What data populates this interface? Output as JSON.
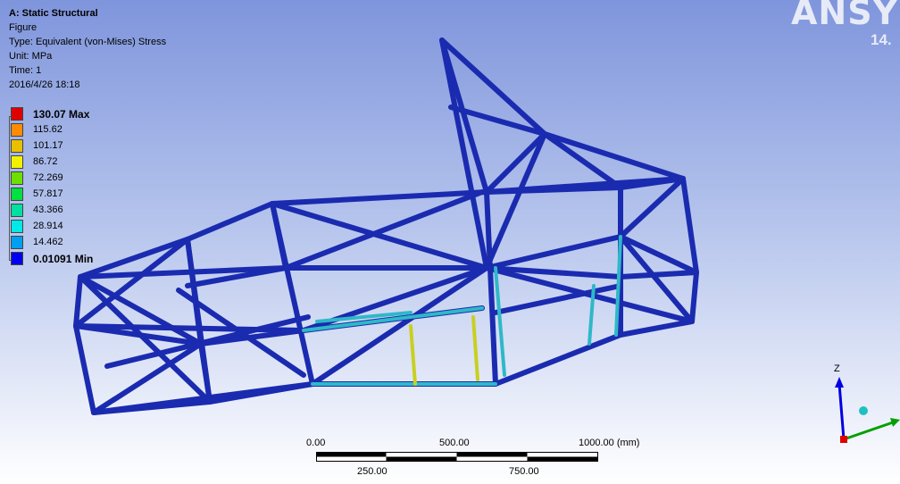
{
  "header": {
    "analysis": "A: Static Structural",
    "figure": "Figure",
    "type": "Type: Equivalent (von-Mises) Stress",
    "unit": "Unit: MPa",
    "time": "Time: 1",
    "date": "2016/4/26 18:18"
  },
  "legend": [
    {
      "label": "130.07 Max",
      "color": "#e00000",
      "bold": true
    },
    {
      "label": "115.62",
      "color": "#ff8c00",
      "bold": false
    },
    {
      "label": "101.17",
      "color": "#e8c000",
      "bold": false
    },
    {
      "label": "86.72",
      "color": "#f2f200",
      "bold": false
    },
    {
      "label": "72.269",
      "color": "#6ee000",
      "bold": false
    },
    {
      "label": "57.817",
      "color": "#00e040",
      "bold": false
    },
    {
      "label": "43.366",
      "color": "#00e0a0",
      "bold": false
    },
    {
      "label": "28.914",
      "color": "#00e8e8",
      "bold": false
    },
    {
      "label": "14.462",
      "color": "#00a0f0",
      "bold": false
    },
    {
      "label": "0.01091 Min",
      "color": "#0000f0",
      "bold": true
    }
  ],
  "brand": {
    "name": "ANSYS",
    "version": "14."
  },
  "scalebar": {
    "top_labels": [
      "0.00",
      "500.00",
      "1000.00 (mm)"
    ],
    "bottom_labels": [
      "250.00",
      "750.00"
    ]
  },
  "triad": {
    "z_label": "Z"
  },
  "colors": {
    "tube": "#1a2bb0",
    "tube_dark": "#0c1680",
    "hot": "#2fb8c8",
    "warm": "#c8d020"
  }
}
